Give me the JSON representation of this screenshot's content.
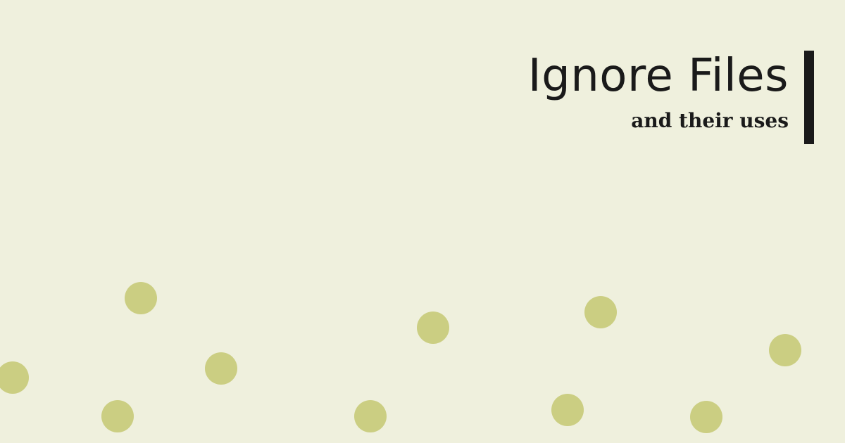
{
  "banner": {
    "title": "Ignore Files",
    "subtitle": "and their uses"
  },
  "colors": {
    "background": "#EFF0DD",
    "text": "#1A1A1A",
    "accent_bar": "#1A1A1A",
    "dots": "#CBCE82"
  }
}
